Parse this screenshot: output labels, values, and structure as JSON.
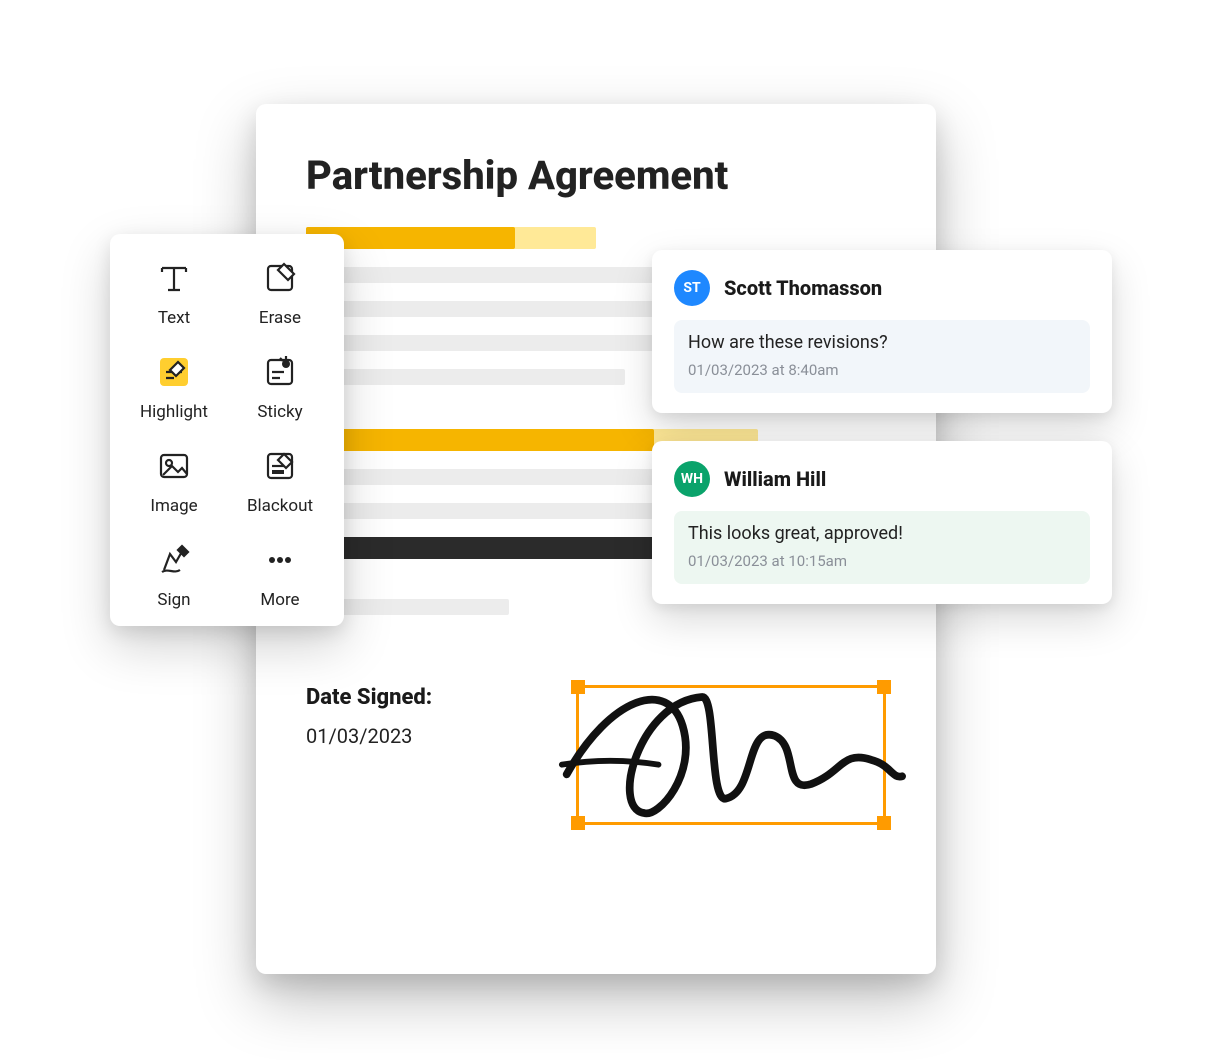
{
  "document": {
    "title": "Partnership Agreement",
    "date_signed_label": "Date Signed:",
    "date_signed_value": "01/03/2023"
  },
  "toolbar": {
    "tools": [
      {
        "id": "text",
        "label": "Text",
        "icon": "text-icon"
      },
      {
        "id": "erase",
        "label": "Erase",
        "icon": "erase-icon"
      },
      {
        "id": "highlight",
        "label": "Highlight",
        "icon": "highlight-icon",
        "active": true
      },
      {
        "id": "sticky",
        "label": "Sticky",
        "icon": "sticky-icon"
      },
      {
        "id": "image",
        "label": "Image",
        "icon": "image-icon"
      },
      {
        "id": "blackout",
        "label": "Blackout",
        "icon": "blackout-icon"
      },
      {
        "id": "sign",
        "label": "Sign",
        "icon": "sign-icon"
      },
      {
        "id": "more",
        "label": "More",
        "icon": "more-icon"
      }
    ]
  },
  "comments": [
    {
      "initials": "ST",
      "avatar_color": "#1e88ff",
      "name": "Scott Thomasson",
      "message": "How are these revisions?",
      "timestamp": "01/03/2023 at 8:40am",
      "tone": "blue"
    },
    {
      "initials": "WH",
      "avatar_color": "#0aa36b",
      "name": "William Hill",
      "message": "This looks great, approved!",
      "timestamp": "01/03/2023 at 10:15am",
      "tone": "green"
    }
  ],
  "colors": {
    "highlight": "#f6b500",
    "highlight_light": "#ffe997",
    "selection_orange": "#ff9b00",
    "blackout": "#2b2b2b"
  }
}
